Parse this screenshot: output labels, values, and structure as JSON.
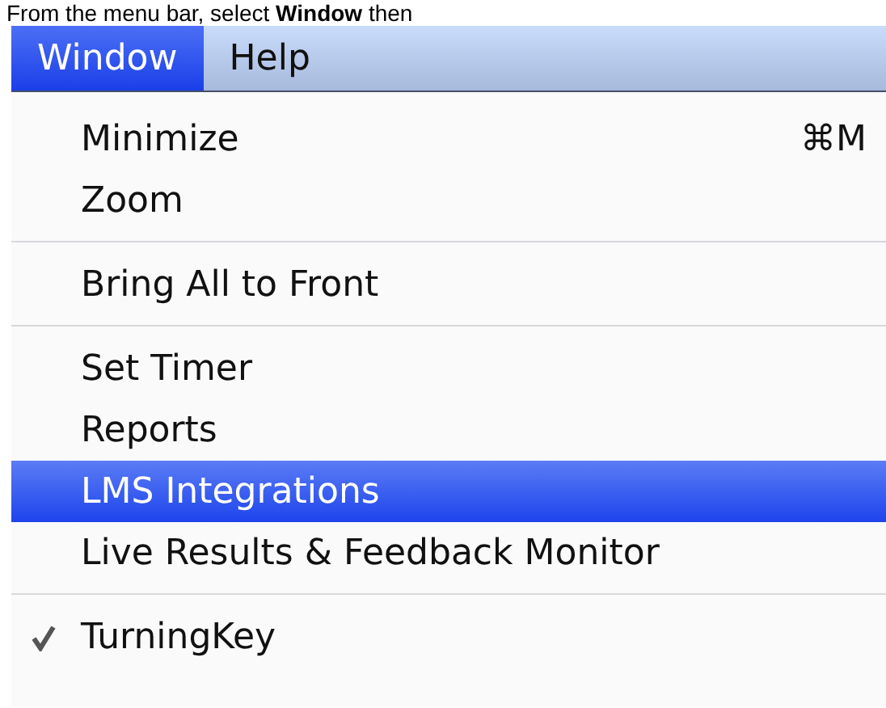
{
  "instruction": "From the menu bar, select **Window** then",
  "menu_bar": [
    {
      "label": "Window",
      "selected": true
    },
    {
      "label": "Help",
      "selected": false
    }
  ],
  "menu": [
    {
      "kind": "item",
      "label": "Minimize",
      "shortcut": "⌘M",
      "selected": false,
      "checked": false
    },
    {
      "kind": "item",
      "label": "Zoom",
      "selected": false,
      "checked": false
    },
    {
      "kind": "separator"
    },
    {
      "kind": "item",
      "label": "Bring All to Front",
      "selected": false,
      "checked": false
    },
    {
      "kind": "separator"
    },
    {
      "kind": "item",
      "label": "Set Timer",
      "selected": false,
      "checked": false
    },
    {
      "kind": "item",
      "label": "Reports",
      "selected": false,
      "checked": false
    },
    {
      "kind": "item",
      "label": "LMS Integrations",
      "selected": true,
      "checked": false
    },
    {
      "kind": "item",
      "label": "Live Results & Feedback Monitor",
      "selected": false,
      "checked": false
    },
    {
      "kind": "separator"
    },
    {
      "kind": "item",
      "label": "TurningKey",
      "selected": false,
      "checked": true
    }
  ]
}
